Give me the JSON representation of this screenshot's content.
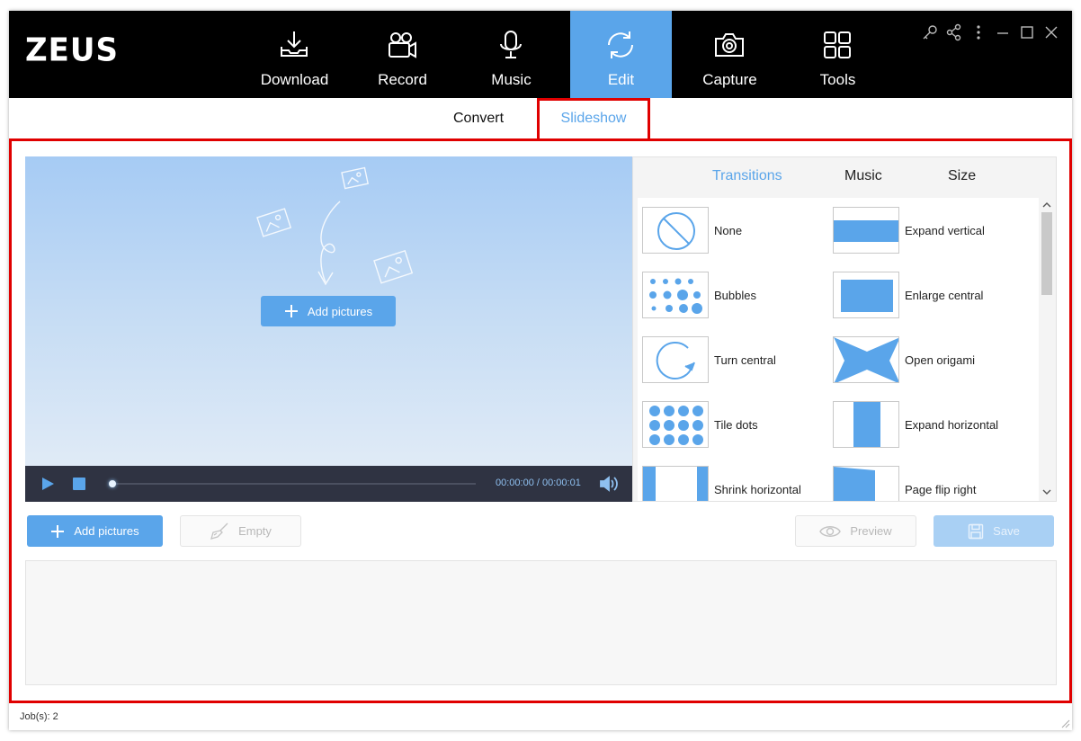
{
  "app": {
    "logo": "ZEUS"
  },
  "nav": [
    {
      "label": "Download",
      "icon": "download-icon"
    },
    {
      "label": "Record",
      "icon": "video-camera-icon"
    },
    {
      "label": "Music",
      "icon": "microphone-icon"
    },
    {
      "label": "Edit",
      "icon": "refresh-icon",
      "active": true
    },
    {
      "label": "Capture",
      "icon": "camera-icon"
    },
    {
      "label": "Tools",
      "icon": "tools-grid-icon"
    }
  ],
  "window_controls": [
    "key-icon",
    "share-icon",
    "more-icon",
    "minimize-icon",
    "maximize-icon",
    "close-icon"
  ],
  "subtabs": {
    "convert": "Convert",
    "slideshow": "Slideshow",
    "active": "Slideshow"
  },
  "preview": {
    "add_pictures": "Add pictures",
    "time": "00:00:00 / 00:00:01",
    "progress": 0
  },
  "panel": {
    "tabs": {
      "transitions": "Transitions",
      "music": "Music",
      "size": "Size"
    },
    "active_tab": "Transitions",
    "transitions": [
      {
        "name": "None"
      },
      {
        "name": "Expand vertical"
      },
      {
        "name": "Bubbles"
      },
      {
        "name": "Enlarge central"
      },
      {
        "name": "Turn central"
      },
      {
        "name": "Open origami"
      },
      {
        "name": "Tile dots"
      },
      {
        "name": "Expand horizontal"
      },
      {
        "name": "Shrink horizontal"
      },
      {
        "name": "Page flip right"
      }
    ]
  },
  "actions": {
    "add_pictures": "Add pictures",
    "empty": "Empty",
    "preview": "Preview",
    "save": "Save"
  },
  "status": {
    "jobs": "Job(s): 2"
  },
  "colors": {
    "accent": "#5aa5ea",
    "highlight": "#e00000",
    "topbar": "#000000"
  }
}
